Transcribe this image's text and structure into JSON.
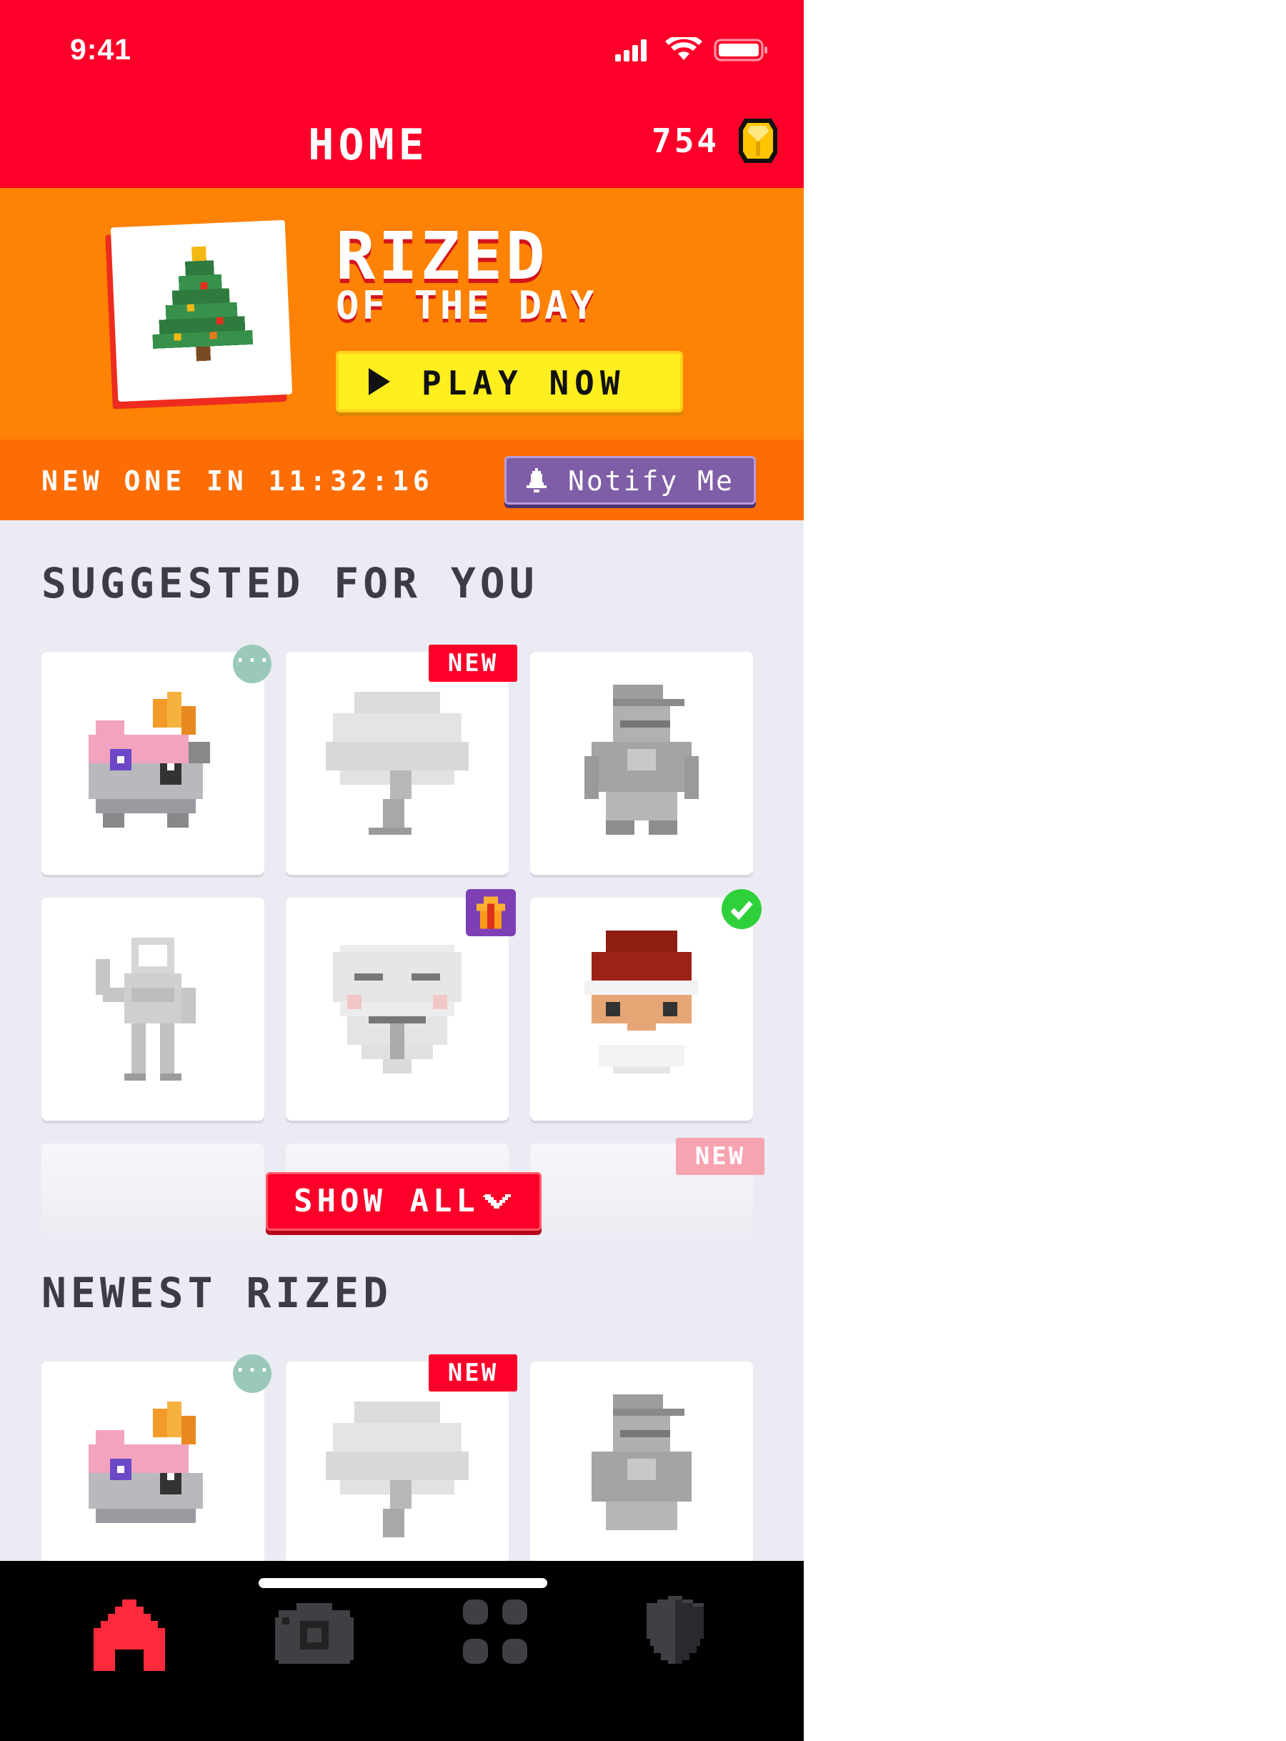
{
  "status_bar": {
    "time": "9:41"
  },
  "header": {
    "title": "HOME",
    "coins": "754"
  },
  "promo": {
    "title": "RIZED",
    "subtitle": "OF THE DAY",
    "play_label": "PLAY NOW",
    "countdown_label": "NEW ONE IN",
    "countdown_time": "11:32:16",
    "notify_label": "Notify Me"
  },
  "suggested": {
    "title": "SUGGESTED FOR YOU",
    "items": [
      {
        "art": "monster-icon",
        "badge": "dots",
        "badge_text": "···"
      },
      {
        "art": "tree-icon",
        "badge": "new",
        "badge_text": "NEW"
      },
      {
        "art": "rapper-icon",
        "badge": "",
        "badge_text": ""
      },
      {
        "art": "astronaut-icon",
        "badge": "",
        "badge_text": ""
      },
      {
        "art": "mask-icon",
        "badge": "gift",
        "badge_text": ""
      },
      {
        "art": "santa-icon",
        "badge": "check",
        "badge_text": ""
      }
    ],
    "faded_badge": "NEW",
    "show_all_label": "SHOW ALL"
  },
  "newest": {
    "title": "NEWEST RIZED",
    "items": [
      {
        "art": "monster-icon",
        "badge": "dots",
        "badge_text": "···"
      },
      {
        "art": "tree-icon",
        "badge": "new",
        "badge_text": "NEW"
      },
      {
        "art": "rapper-icon",
        "badge": "",
        "badge_text": ""
      }
    ]
  },
  "nav": {
    "items": [
      {
        "icon": "home-icon",
        "active": true
      },
      {
        "icon": "camera-icon",
        "active": false
      },
      {
        "icon": "grid-icon",
        "active": false
      },
      {
        "icon": "shield-icon",
        "active": false
      }
    ]
  },
  "colors": {
    "primary": "#fd0029",
    "promo": "#fe8203",
    "accent": "#ffef1e",
    "notify": "#7e5ea6",
    "background": "#ebebf3"
  }
}
